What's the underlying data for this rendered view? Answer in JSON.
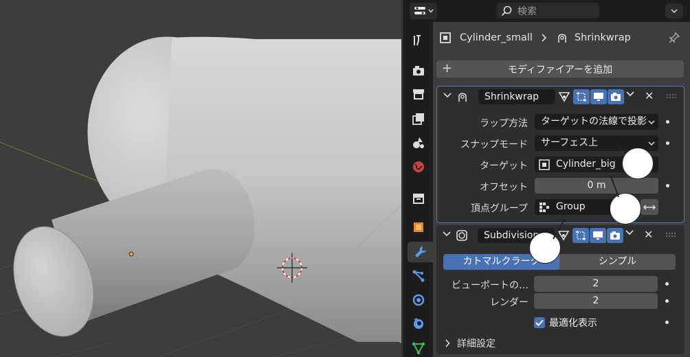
{
  "search": {
    "placeholder": "検索"
  },
  "breadcrumb": {
    "object": "Cylinder_small",
    "modifier": "Shrinkwrap"
  },
  "add_modifier_label": "モディファイアーを追加",
  "shrinkwrap": {
    "name": "Shrinkwrap",
    "rows": {
      "wrap_method": {
        "label": "ラップ方法",
        "value": "ターゲットの法線で投影"
      },
      "snap_mode": {
        "label": "スナップモード",
        "value": "サーフェス上"
      },
      "target": {
        "label": "ターゲット",
        "value": "Cylinder_big"
      },
      "offset": {
        "label": "オフセット",
        "value": "0 m"
      },
      "vertex_group": {
        "label": "頂点グループ",
        "value": "Group"
      }
    }
  },
  "subdivision": {
    "name": "Subdivision",
    "type_options": [
      "カトマルクラーク",
      "シンプル"
    ],
    "selected_type": "カトマルクラーク",
    "rows": {
      "viewport": {
        "label": "ビューポートの…",
        "value": "2"
      },
      "render": {
        "label": "レンダー",
        "value": "2"
      },
      "optimal": {
        "label": "最適化表示",
        "checked": true
      }
    },
    "advanced_label": "詳細設定"
  },
  "colors": {
    "accent": "#4772b3",
    "active_outline": "#4f7fb9",
    "panel": "#2e2e2e",
    "background": "#3d3d3d"
  }
}
